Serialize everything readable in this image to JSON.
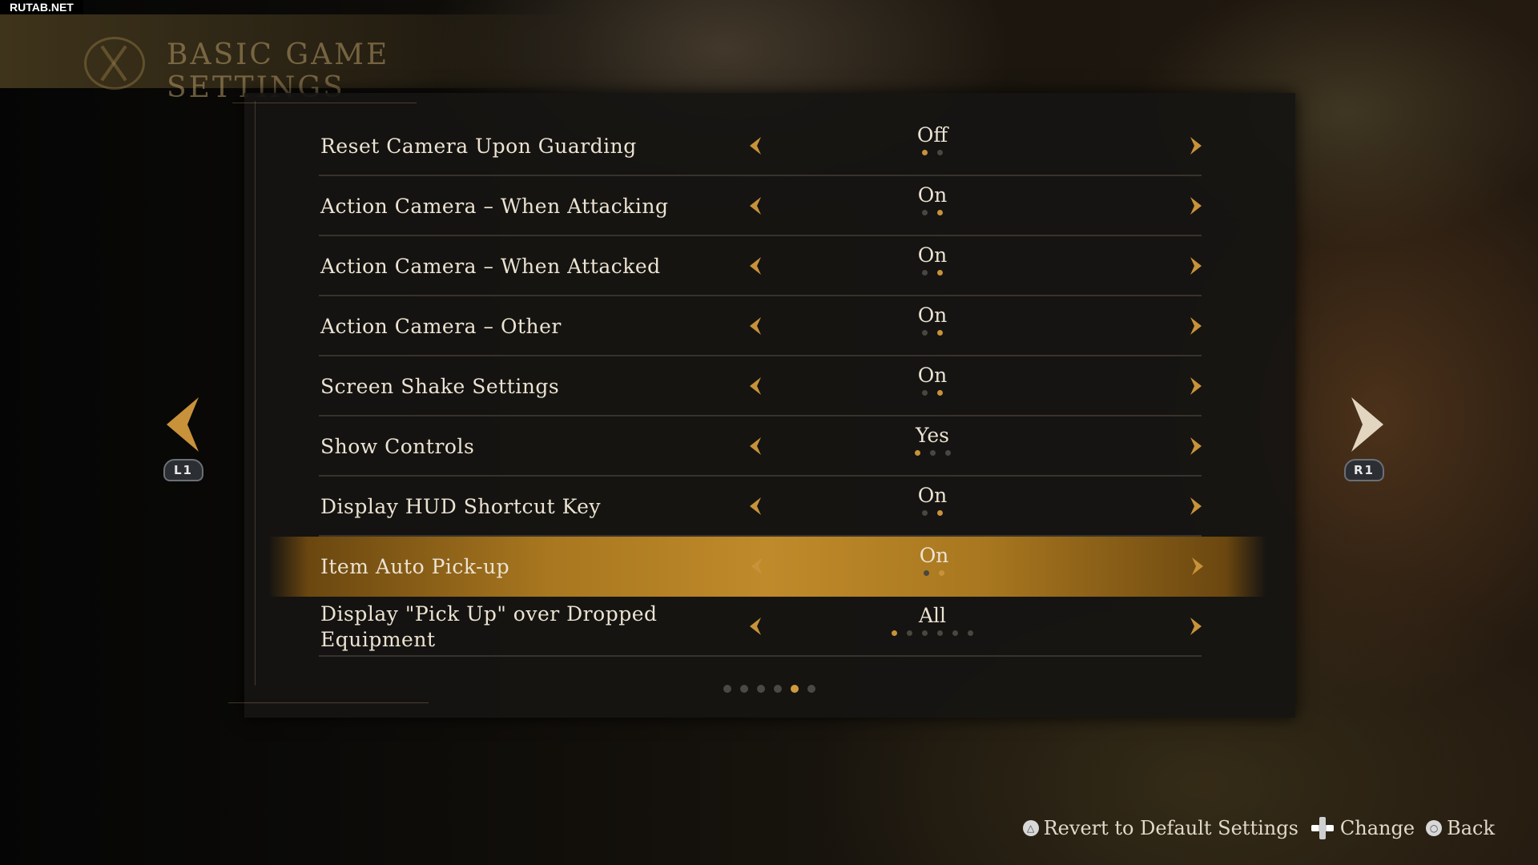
{
  "watermark": "RUTAB.NET",
  "header": {
    "title": "BASIC GAME SETTINGS"
  },
  "nav": {
    "prev_button": "L1",
    "next_button": "R1"
  },
  "settings": [
    {
      "label": "Reset Camera Upon Guarding",
      "value": "Off",
      "options_count": 2,
      "selected_index": 0
    },
    {
      "label": "Action Camera – When Attacking",
      "value": "On",
      "options_count": 2,
      "selected_index": 1
    },
    {
      "label": "Action Camera – When Attacked",
      "value": "On",
      "options_count": 2,
      "selected_index": 1
    },
    {
      "label": "Action Camera – Other",
      "value": "On",
      "options_count": 2,
      "selected_index": 1
    },
    {
      "label": "Screen Shake Settings",
      "value": "On",
      "options_count": 2,
      "selected_index": 1
    },
    {
      "label": "Show Controls",
      "value": "Yes",
      "options_count": 3,
      "selected_index": 0
    },
    {
      "label": "Display HUD Shortcut Key",
      "value": "On",
      "options_count": 2,
      "selected_index": 1
    },
    {
      "label": "Item Auto Pick-up",
      "value": "On",
      "options_count": 2,
      "selected_index": 1,
      "highlighted": true
    },
    {
      "label": "Display \"Pick Up\" over Dropped Equipment",
      "value": "All",
      "options_count": 6,
      "selected_index": 0
    }
  ],
  "pagination": {
    "pages": 6,
    "current_page": 5
  },
  "footer": {
    "revert_label": "Revert to Default Settings",
    "change_label": "Change",
    "back_label": "Back"
  },
  "colors": {
    "accent": "#c8923a",
    "highlight": "#bf8a2a",
    "panel": "#161412",
    "text": "#ece3d2"
  }
}
